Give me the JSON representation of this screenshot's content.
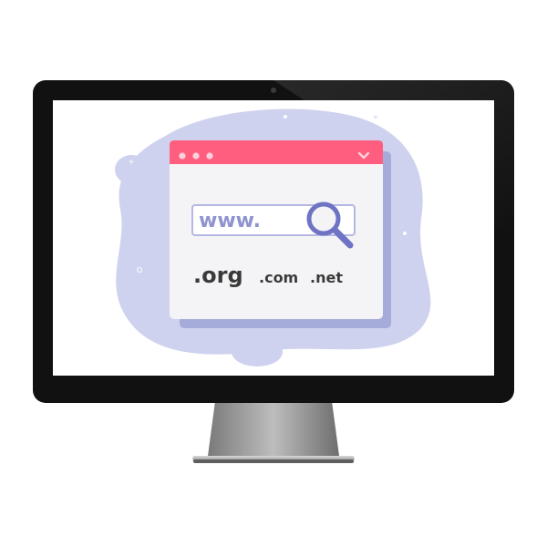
{
  "scene": {
    "address_prefix": "www.",
    "domains": [
      {
        "label": ".org",
        "emphasis": "primary"
      },
      {
        "label": ".com",
        "emphasis": "secondary"
      },
      {
        "label": ".net",
        "emphasis": "secondary"
      }
    ],
    "window_controls": [
      "dot",
      "dot",
      "dot"
    ]
  },
  "icons": {
    "search": "magnifier-icon",
    "chevron": "chevron-down-icon",
    "camera": "webcam-icon"
  },
  "colors": {
    "bezel": "#111111",
    "screen": "#ffffff",
    "blob": "#cfd2ee",
    "window_header": "#ff5e7e",
    "window_body": "#f4f4f6",
    "window_shadow": "#a6acd9",
    "accent": "#6f73c4",
    "text_primary": "#3a3a3a",
    "stand": "#9a9a9a"
  }
}
